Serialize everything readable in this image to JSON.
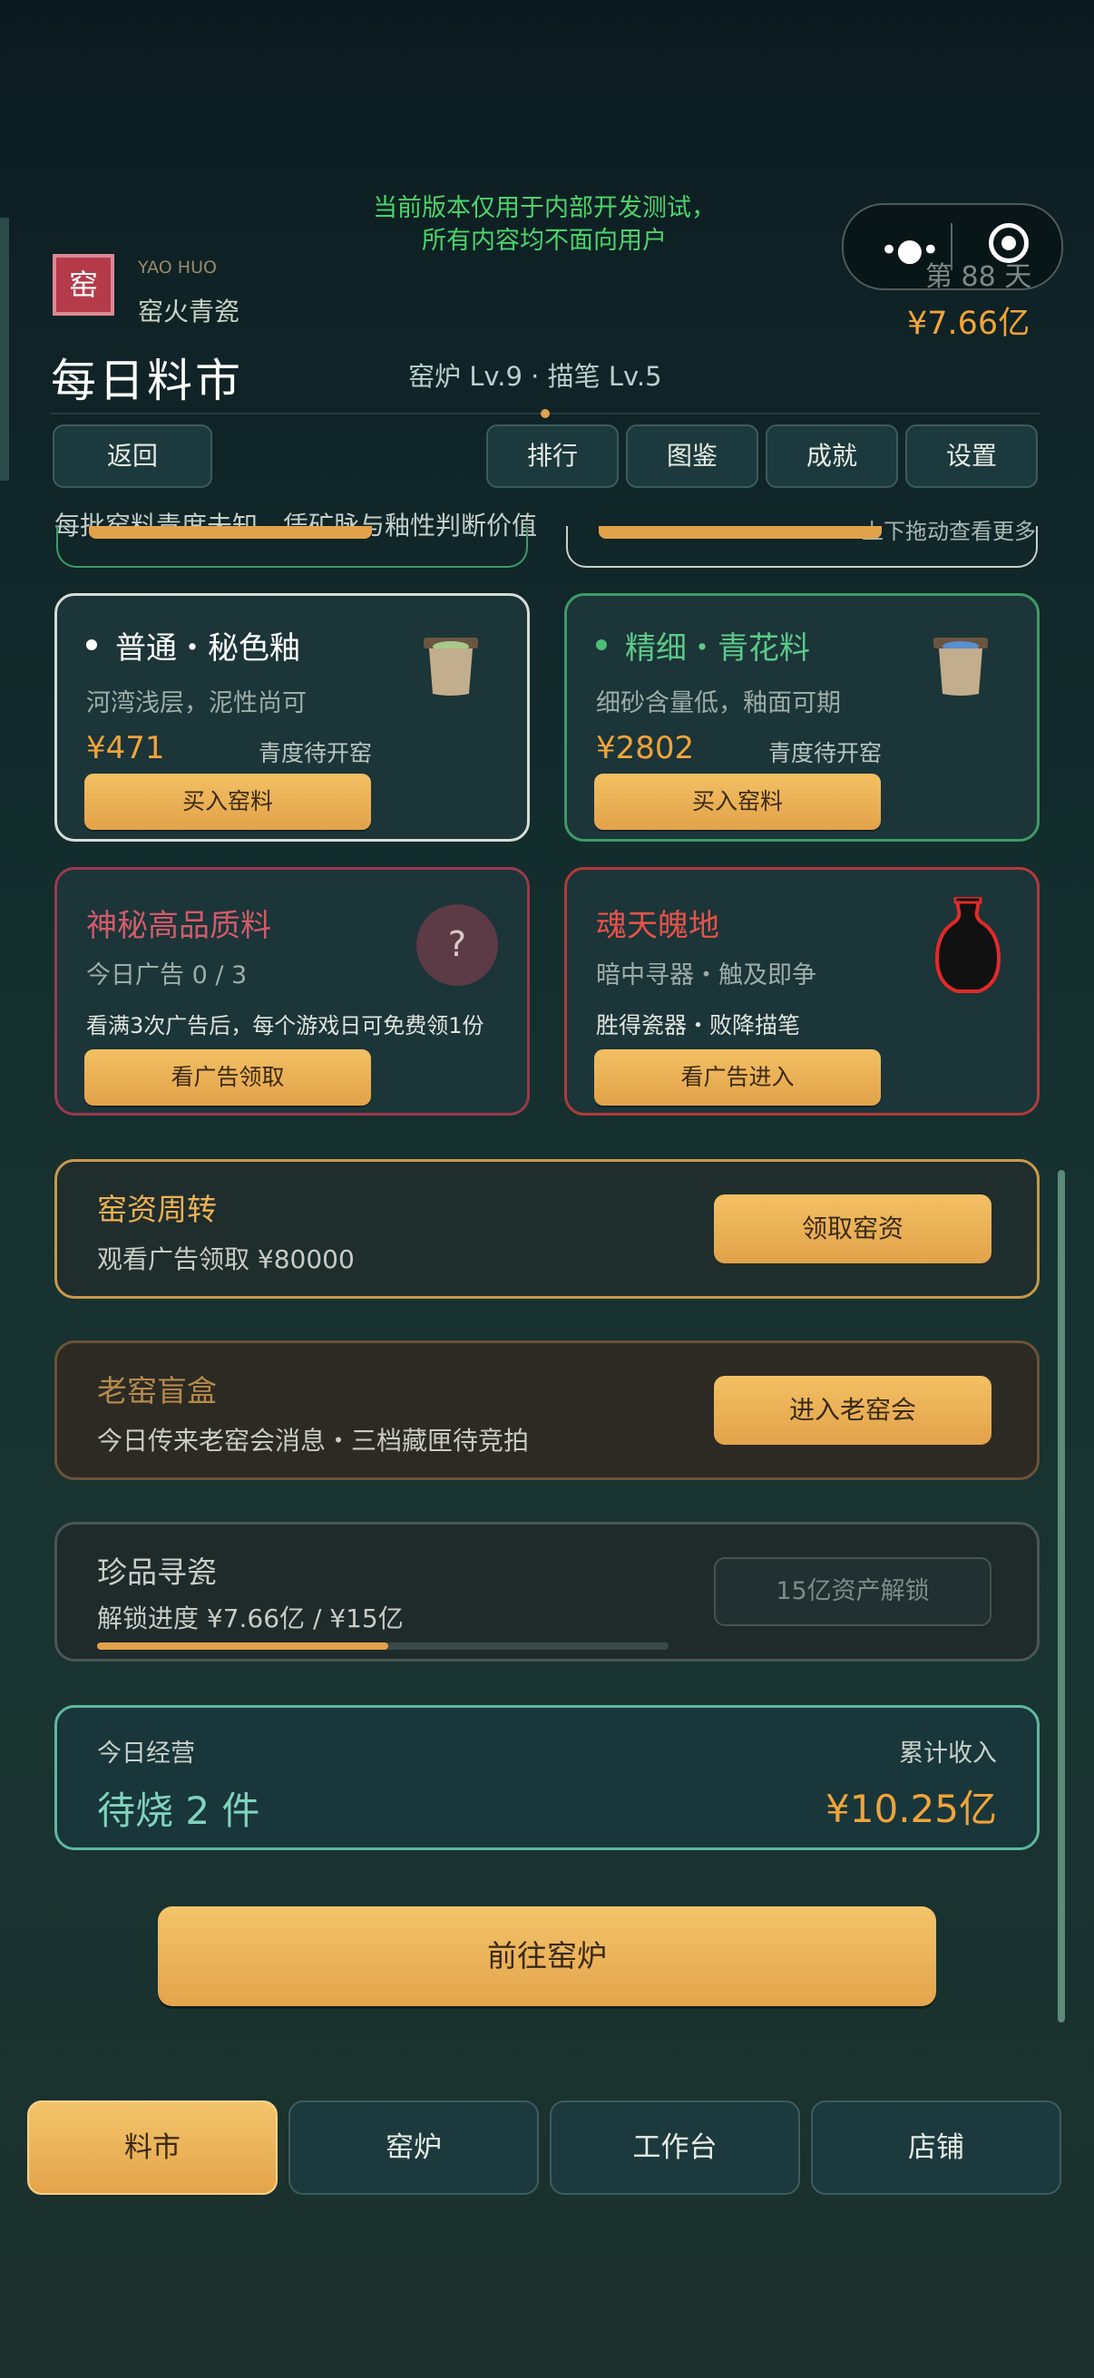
{
  "notice": {
    "line1": "当前版本仅用于内部开发测试，",
    "line2": "所有内容均不面向用户"
  },
  "brand": {
    "seal": "窑",
    "en": "YAO HUO",
    "cn": "窑火青瓷"
  },
  "stats": {
    "day": "第 88 天",
    "money": "¥7.66亿"
  },
  "page": {
    "title": "每日料市",
    "levels": "窑炉 Lv.9 · 描笔 Lv.5"
  },
  "nav": {
    "back": "返回",
    "rank": "排行",
    "atlas": "图鉴",
    "achievements": "成就",
    "settings": "设置"
  },
  "hints": {
    "left": "每批窑料青度未知，凭矿脉与釉性判断价值",
    "right": "上下拖动查看更多"
  },
  "cards": {
    "normal": {
      "title": "普通・秘色釉",
      "desc": "河湾浅层，泥性尚可",
      "price": "¥471",
      "status": "青度待开窑",
      "button": "买入窑料"
    },
    "fine": {
      "title": "精细・青花料",
      "desc": "细砂含量低，釉面可期",
      "price": "¥2802",
      "status": "青度待开窑",
      "button": "买入窑料"
    },
    "mystery": {
      "title": "神秘高品质料",
      "quota": "今日广告 0 / 3",
      "desc": "看满3次广告后，每个游戏日可免费领1份",
      "badge": "?",
      "button": "看广告领取"
    },
    "soul": {
      "title": "魂天魄地",
      "desc1": "暗中寻器・触及即争",
      "desc2": "胜得瓷器・败降描笔",
      "button": "看广告进入"
    }
  },
  "panels": {
    "capital": {
      "title": "窑资周转",
      "desc": "观看广告领取 ¥80000",
      "button": "领取窑资"
    },
    "blindbox": {
      "title": "老窑盲盒",
      "desc": "今日传来老窑会消息・三档藏匣待竞拍",
      "button": "进入老窑会"
    },
    "treasure": {
      "title": "珍品寻瓷",
      "desc": "解锁进度 ¥7.66亿 / ¥15亿",
      "button": "15亿资产解锁",
      "progress": 0.51
    }
  },
  "summary": {
    "label": "今日经营",
    "value": "待烧 2 件",
    "income_label": "累计收入",
    "income": "¥10.25亿"
  },
  "go_button": "前往窑炉",
  "tabs": [
    "料市",
    "窑炉",
    "工作台",
    "店铺"
  ],
  "colors": {
    "accent": "#e6a84c",
    "green": "#4dbd7a",
    "red": "#e5524a"
  }
}
